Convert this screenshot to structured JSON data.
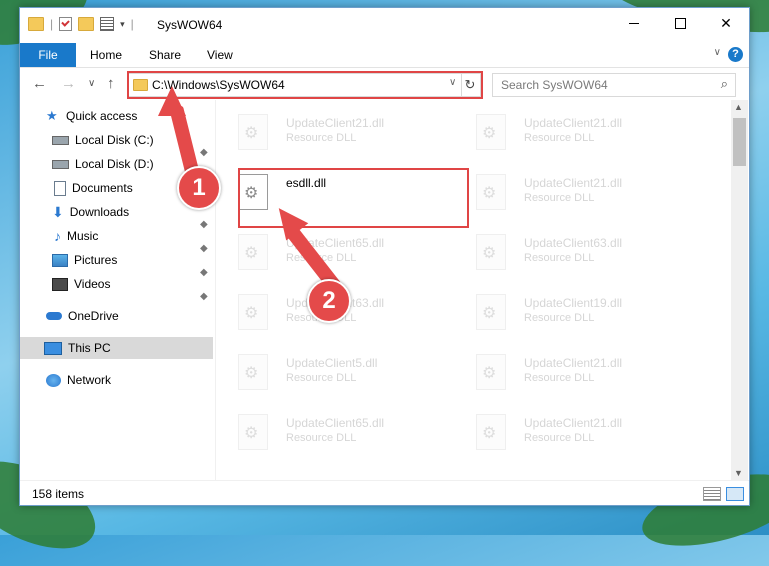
{
  "window": {
    "title": "SysWOW64",
    "minimize_glyph": "",
    "maximize_glyph": "",
    "close_glyph": "✕"
  },
  "ribbon": {
    "tabs": [
      {
        "label": "File"
      },
      {
        "label": "Home"
      },
      {
        "label": "Share"
      },
      {
        "label": "View"
      }
    ],
    "help_glyph": "?",
    "expand_glyph": "∨"
  },
  "address_bar": {
    "path": "C:\\Windows\\SysWOW64",
    "dropdown_glyph": "∨",
    "refresh_glyph": "↻"
  },
  "nav_buttons": {
    "back_glyph": "←",
    "forward_glyph": "→",
    "recent_glyph": "∨",
    "up_glyph": "↑"
  },
  "search": {
    "placeholder": "Search SysWOW64",
    "icon_glyph": "⌕"
  },
  "sidebar": {
    "items": [
      {
        "label": "Quick access",
        "icon": "star-icon"
      },
      {
        "label": "Local Disk (C:)",
        "icon": "drive-icon",
        "pinned": true
      },
      {
        "label": "Local Disk (D:)",
        "icon": "drive-icon",
        "pinned": true
      },
      {
        "label": "Documents",
        "icon": "documents-icon",
        "pinned": true
      },
      {
        "label": "Downloads",
        "icon": "downloads-icon",
        "pinned": true
      },
      {
        "label": "Music",
        "icon": "music-icon",
        "pinned": true
      },
      {
        "label": "Pictures",
        "icon": "pictures-icon",
        "pinned": true
      },
      {
        "label": "Videos",
        "icon": "videos-icon",
        "pinned": true
      },
      {
        "label": "OneDrive",
        "icon": "onedrive-icon"
      },
      {
        "label": "This PC",
        "icon": "pc-icon",
        "selected": true
      },
      {
        "label": "Network",
        "icon": "network-icon"
      }
    ],
    "pin_glyph": "📌"
  },
  "files": {
    "left": [
      {
        "name": "UpdateClient21.dll",
        "type": "Resource DLL"
      },
      {
        "name": "esdll.dll",
        "type": ""
      },
      {
        "name": "UpdateClient65.dll",
        "type": "Resource DLL"
      },
      {
        "name": "UpdateClient63.dll",
        "type": "Resource DLL"
      },
      {
        "name": "UpdateClient5.dll",
        "type": "Resource DLL"
      },
      {
        "name": "UpdateClient65.dll",
        "type": "Resource DLL"
      }
    ],
    "right": [
      {
        "name": "UpdateClient21.dll",
        "type": "Resource DLL"
      },
      {
        "name": "UpdateClient21.dll",
        "type": "Resource DLL"
      },
      {
        "name": "UpdateClient63.dll",
        "type": "Resource DLL"
      },
      {
        "name": "UpdateClient19.dll",
        "type": "Resource DLL"
      },
      {
        "name": "UpdateClient21.dll",
        "type": "Resource DLL"
      },
      {
        "name": "UpdateClient21.dll",
        "type": "Resource DLL"
      }
    ]
  },
  "status": {
    "item_count": "158 items"
  },
  "annotations": {
    "step1": "1",
    "step2": "2",
    "color": "#e44a4a"
  }
}
